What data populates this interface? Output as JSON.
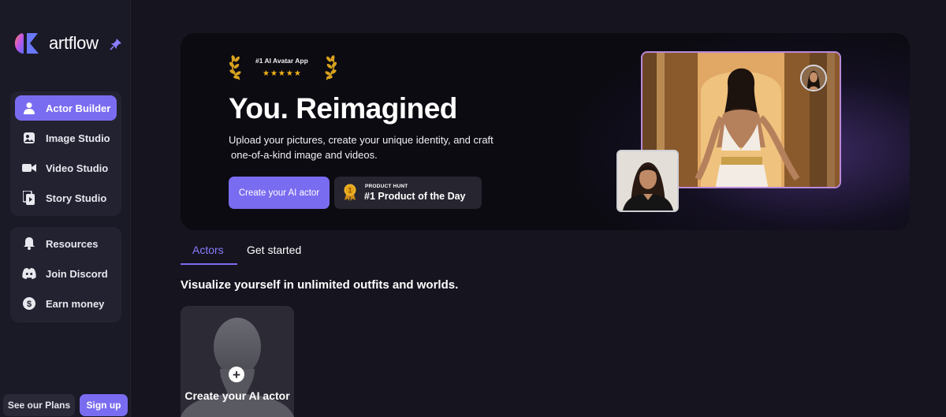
{
  "brand": {
    "name": "artflow",
    "accent": "#7a6cf0"
  },
  "sidebar": {
    "primary": [
      {
        "label": "Actor Builder",
        "icon": "person-icon",
        "active": true
      },
      {
        "label": "Image Studio",
        "icon": "image-icon",
        "active": false
      },
      {
        "label": "Video Studio",
        "icon": "video-camera-icon",
        "active": false
      },
      {
        "label": "Story Studio",
        "icon": "story-icon",
        "active": false
      }
    ],
    "secondary": [
      {
        "label": "Resources",
        "icon": "bell-icon"
      },
      {
        "label": "Join Discord",
        "icon": "discord-icon"
      },
      {
        "label": "Earn money",
        "icon": "dollar-icon"
      }
    ],
    "plans_label": "See our Plans",
    "signup_label": "Sign up"
  },
  "hero": {
    "award_text": "#1 AI Avatar App",
    "award_stars": "★★★★★",
    "title": "You. Reimagined",
    "description_line1": "Upload your pictures, create your unique identity, and craft",
    "description_line2": "one-of-a-kind image and videos.",
    "cta_label": "Create your AI actor",
    "product_hunt_small": "PRODUCT HUNT",
    "product_hunt_big": "#1 Product of the Day"
  },
  "tabs": [
    {
      "label": "Actors",
      "active": true
    },
    {
      "label": "Get started",
      "active": false
    }
  ],
  "section_title": "Visualize yourself in unlimited outfits and worlds.",
  "create_card": {
    "label": "Create your AI actor"
  }
}
